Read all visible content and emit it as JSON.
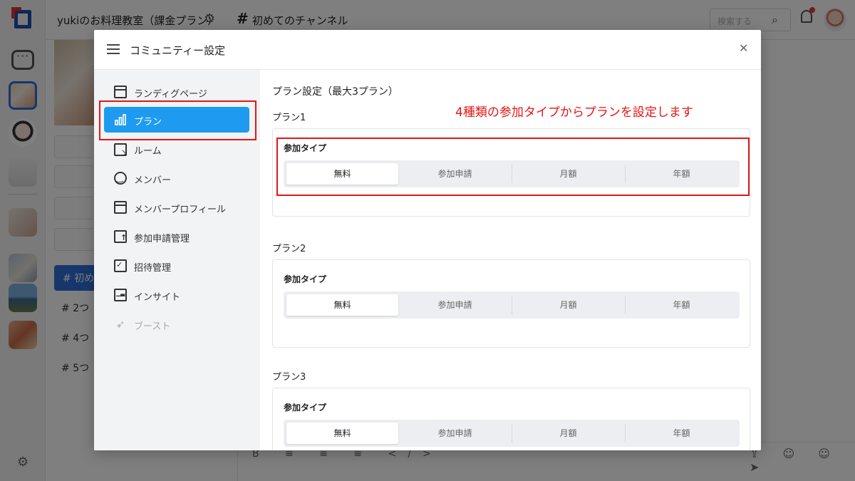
{
  "app": {
    "workspace_title": "yukiのお料理教室（課金プラン）",
    "channel_name": "初めてのチャンネル",
    "search_placeholder": "検索する",
    "sidebar_active_channel": "初め",
    "sidebar_channels": [
      "2つ",
      "4つ",
      "5つ"
    ]
  },
  "modal": {
    "title": "コミュニティー設定",
    "nav": [
      {
        "label": "ランディグページ",
        "icon": "window-icon",
        "active": false
      },
      {
        "label": "プラン",
        "icon": "bar-chart-icon",
        "active": true
      },
      {
        "label": "ルーム",
        "icon": "room-icon",
        "active": false
      },
      {
        "label": "メンバー",
        "icon": "smile-icon",
        "active": false
      },
      {
        "label": "メンバープロフィール",
        "icon": "window-icon",
        "active": false
      },
      {
        "label": "参加申請管理",
        "icon": "document-upload-icon",
        "active": false
      },
      {
        "label": "招待管理",
        "icon": "clipboard-check-icon",
        "active": false
      },
      {
        "label": "インサイト",
        "icon": "chart-icon",
        "active": false
      },
      {
        "label": "ブースト",
        "icon": "rocket-icon",
        "active": false,
        "disabled": true
      }
    ],
    "content": {
      "heading": "プラン設定（最大3プラン）",
      "annotation": "4種類の参加タイプからプランを設定します",
      "plans": [
        {
          "label": "プラン1",
          "field_label": "参加タイプ",
          "options": [
            "無料",
            "参加申請",
            "月額",
            "年額"
          ],
          "selected": "無料"
        },
        {
          "label": "プラン2",
          "field_label": "参加タイプ",
          "options": [
            "無料",
            "参加申請",
            "月額",
            "年額"
          ],
          "selected": "無料"
        },
        {
          "label": "プラン3",
          "field_label": "参加タイプ",
          "options": [
            "無料",
            "参加申請",
            "月額",
            "年額"
          ],
          "selected": "無料"
        }
      ]
    }
  },
  "colors": {
    "accent": "#1e9bf0",
    "annotation_red": "#e51515",
    "nav_bg": "#f1f3f5"
  }
}
